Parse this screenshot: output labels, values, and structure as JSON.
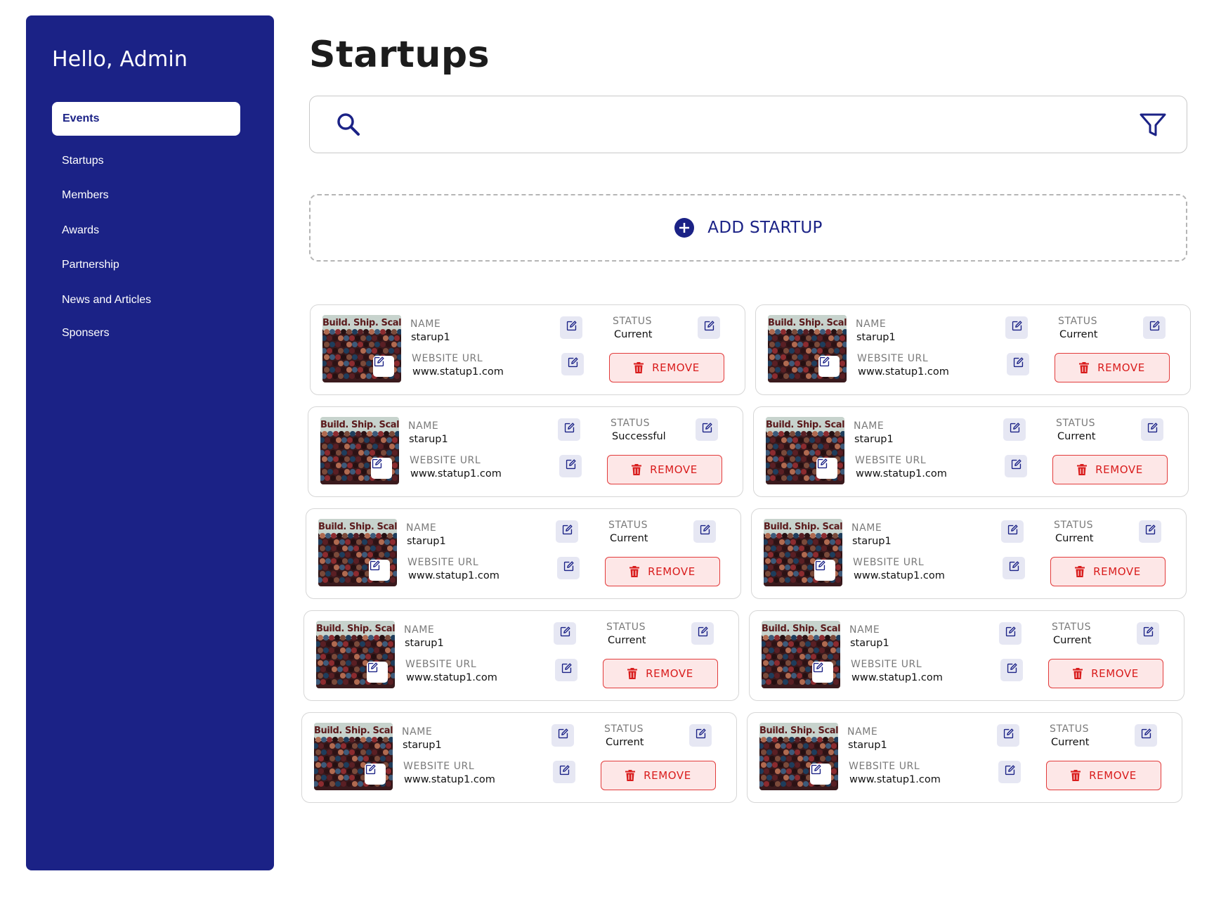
{
  "sidebar": {
    "greeting": "Hello, Admin",
    "active_item": "Events",
    "items": [
      "Startups",
      "Members",
      "Awards",
      "Partnership",
      "News and Articles",
      "Sponsers"
    ]
  },
  "main": {
    "title": "Startups",
    "search": {
      "value": "",
      "placeholder": ""
    },
    "add_label": "ADD STARTUP",
    "thumbnail_text": "Build. Ship. Scale.",
    "labels": {
      "name": "NAME",
      "url": "WEBSITE URL",
      "status": "STATUS",
      "remove": "REMOVE"
    },
    "startups": [
      {
        "name": "starup1",
        "url": "www.statup1.com",
        "status": "Current"
      },
      {
        "name": "starup1",
        "url": "www.statup1.com",
        "status": "Current"
      },
      {
        "name": "starup1",
        "url": "www.statup1.com",
        "status": "Successful"
      },
      {
        "name": "starup1",
        "url": "www.statup1.com",
        "status": "Current"
      },
      {
        "name": "starup1",
        "url": "www.statup1.com",
        "status": "Current"
      },
      {
        "name": "starup1",
        "url": "www.statup1.com",
        "status": "Current"
      },
      {
        "name": "starup1",
        "url": "www.statup1.com",
        "status": "Current"
      },
      {
        "name": "starup1",
        "url": "www.statup1.com",
        "status": "Current"
      },
      {
        "name": "starup1",
        "url": "www.statup1.com",
        "status": "Current"
      },
      {
        "name": "starup1",
        "url": "www.statup1.com",
        "status": "Current"
      }
    ]
  },
  "colors": {
    "brand": "#1b2286",
    "edit_bg": "#e6e7f3",
    "remove_bg": "#fde7e7",
    "remove_border": "#e23b3b",
    "remove_text": "#d91c1c"
  },
  "icons": [
    "search-icon",
    "filter-icon",
    "plus-circle-icon",
    "edit-icon",
    "trash-icon"
  ]
}
